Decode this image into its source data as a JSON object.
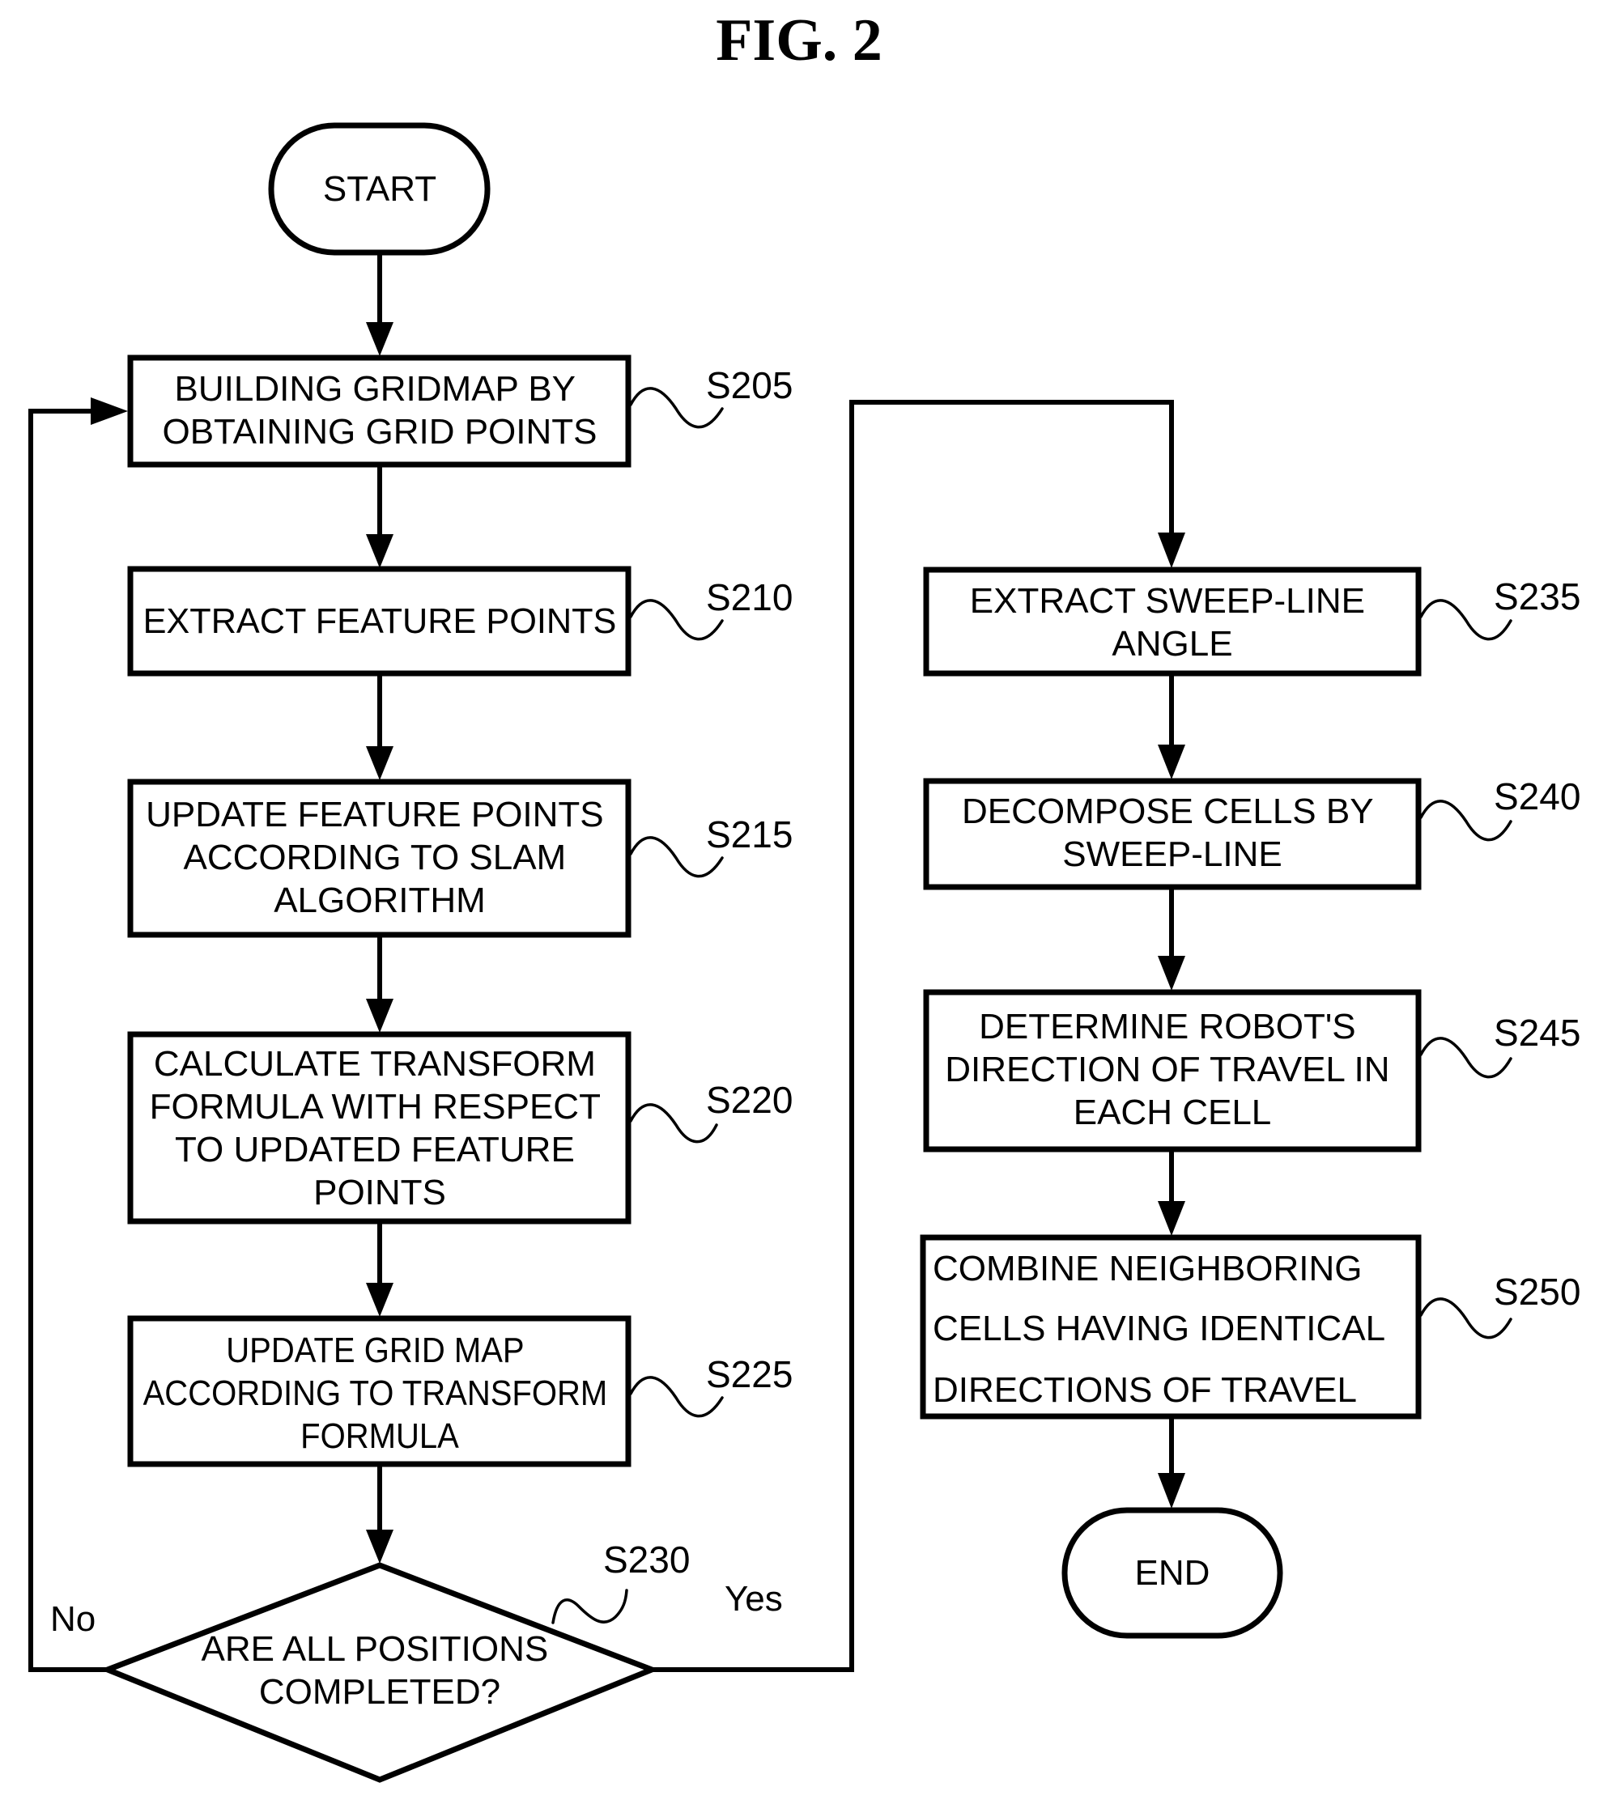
{
  "figure": {
    "title": "FIG. 2"
  },
  "nodes": {
    "start": {
      "label": "START"
    },
    "s205": {
      "id": "S205",
      "lines": [
        "BUILDING GRIDMAP BY",
        "OBTAINING GRID POINTS"
      ]
    },
    "s210": {
      "id": "S210",
      "lines": [
        "EXTRACT FEATURE POINTS"
      ]
    },
    "s215": {
      "id": "S215",
      "lines": [
        "UPDATE FEATURE POINTS",
        "ACCORDING TO SLAM",
        "ALGORITHM"
      ]
    },
    "s220": {
      "id": "S220",
      "lines": [
        "CALCULATE TRANSFORM",
        "FORMULA WITH RESPECT",
        "TO UPDATED FEATURE",
        "POINTS"
      ]
    },
    "s225": {
      "id": "S225",
      "lines": [
        "UPDATE GRID MAP",
        "ACCORDING TO TRANSFORM",
        "FORMULA"
      ]
    },
    "s230": {
      "id": "S230",
      "lines": [
        "ARE ALL POSITIONS",
        "COMPLETED?"
      ],
      "yes_label": "Yes",
      "no_label": "No"
    },
    "s235": {
      "id": "S235",
      "lines": [
        "EXTRACT SWEEP-LINE",
        "ANGLE"
      ]
    },
    "s240": {
      "id": "S240",
      "lines": [
        "DECOMPOSE CELLS BY",
        "SWEEP-LINE"
      ]
    },
    "s245": {
      "id": "S245",
      "lines": [
        "DETERMINE ROBOT'S",
        "DIRECTION OF TRAVEL IN",
        "EACH CELL"
      ]
    },
    "s250": {
      "id": "S250",
      "lines": [
        "COMBINE NEIGHBORING",
        "CELLS HAVING IDENTICAL",
        "DIRECTIONS OF TRAVEL"
      ]
    },
    "end": {
      "label": "END"
    }
  }
}
